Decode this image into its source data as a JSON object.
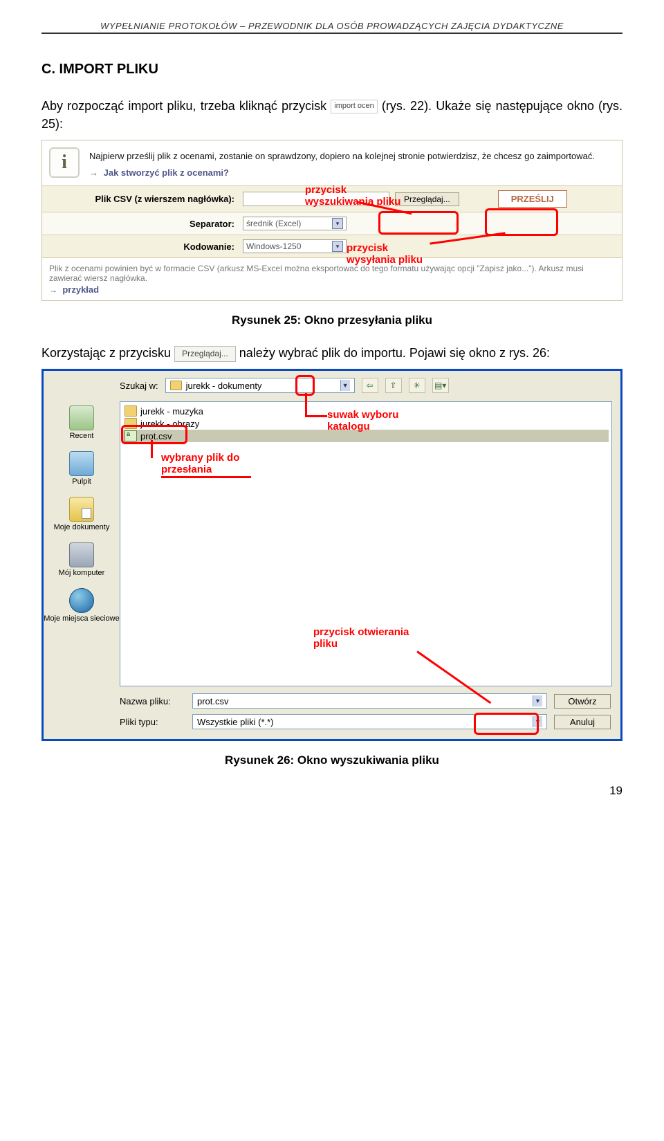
{
  "header": "WYPEŁNIANIE PROTOKOŁÓW – PRZEWODNIK DLA OSÓB PROWADZĄCYCH ZAJĘCIA DYDAKTYCZNE",
  "section_title": "C. IMPORT PLIKU",
  "para1_a": "Aby rozpocząć import pliku, trzeba kliknąć przycisk ",
  "para1_btn": "import ocen",
  "para1_b": " (rys. 22). Ukaże się następujące okno (rys. 25):",
  "shot1": {
    "info_text": "Najpierw prześlij plik z ocenami, zostanie on sprawdzony, dopiero na kolejnej stronie potwierdzisz, że chcesz go zaimportować.",
    "info_link": "Jak stworzyć plik z ocenami?",
    "rows": {
      "csv_label": "Plik CSV (z wierszem nagłówka):",
      "browse": "Przeglądaj...",
      "send": "PRZEŚLIJ",
      "sep_label": "Separator:",
      "sep_value": "średnik (Excel)",
      "enc_label": "Kodowanie:",
      "enc_value": "Windows-1250"
    },
    "footnote": "Plik z ocenami powinien być w formacie CSV (arkusz MS-Excel można eksportować do tego formatu używając opcji \"Zapisz jako...\"). Arkusz musi zawierać wiersz nagłówka.",
    "example_link": "przykład",
    "ann_search": "przycisk\nwyszukiwania pliku",
    "ann_send": "przycisk\nwysyłania pliku"
  },
  "caption1": "Rysunek 25: Okno przesyłania pliku",
  "para2_a": "Korzystając z przycisku ",
  "para2_btn": "Przeglądaj...",
  "para2_b": " należy wybrać plik do importu. Pojawi się okno z rys. 26:",
  "shot2": {
    "lookin_label": "Szukaj w:",
    "lookin_value": "jurekk - dokumenty",
    "files": [
      "jurekk - muzyka",
      "jurekk - obrazy",
      "prot.csv"
    ],
    "sidebar": [
      "Recent",
      "Pulpit",
      "Moje dokumenty",
      "Mój komputer",
      "Moje miejsca sieciowe"
    ],
    "name_label": "Nazwa pliku:",
    "name_value": "prot.csv",
    "type_label": "Pliki typu:",
    "type_value": "Wszystkie pliki (*.*)",
    "open_btn": "Otwórz",
    "cancel_btn": "Anuluj",
    "ann_suwak": "suwak wyboru\nkatalogu",
    "ann_selfile": "wybrany plik do\nprzesłania",
    "ann_open": "przycisk otwierania\npliku"
  },
  "caption2": "Rysunek 26: Okno wyszukiwania pliku",
  "pagenum": "19"
}
